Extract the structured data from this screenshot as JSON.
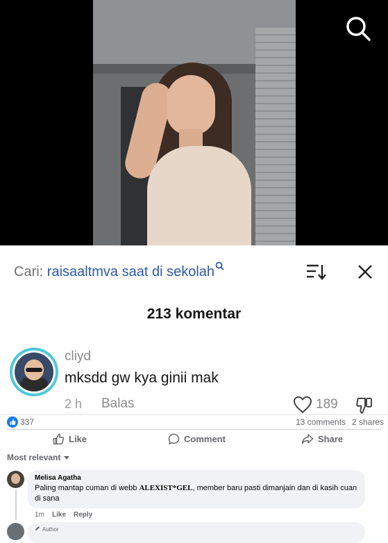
{
  "search_query": {
    "prefix": "Cari:",
    "query": "raisaaltmva saat di sekolah"
  },
  "comment_sheet": {
    "count_label": "213 komentar",
    "comment": {
      "username": "cliyd",
      "text": "mksdd gw kya ginii mak",
      "time": "2 h",
      "reply_label": "Balas",
      "likes": "189"
    }
  },
  "facebook": {
    "reactions_count": "337",
    "comments_count": "13 comments",
    "shares_count": "2 shares",
    "actions": {
      "like": "Like",
      "comment": "Comment",
      "share": "Share"
    },
    "sort_label": "Most relevant",
    "comments": [
      {
        "author": "Melisa Agatha",
        "text_before": "Paling mantap cuman di webb",
        "text_bold": "ALEXIST*GEL",
        "text_after": ", member baru pasti dimanjain dan di kasih cuan di sana",
        "time": "1m",
        "like_label": "Like",
        "reply_label": "Reply"
      },
      {
        "badge": "Author"
      }
    ],
    "brand_color": "#1877f2"
  },
  "icons": [
    "search-icon",
    "sort-icon",
    "close-icon",
    "heart-icon",
    "dislike-icon",
    "like-reaction-icon",
    "thumbs-up-icon",
    "comment-icon",
    "share-icon",
    "chevron-down-icon",
    "pencil-icon"
  ]
}
